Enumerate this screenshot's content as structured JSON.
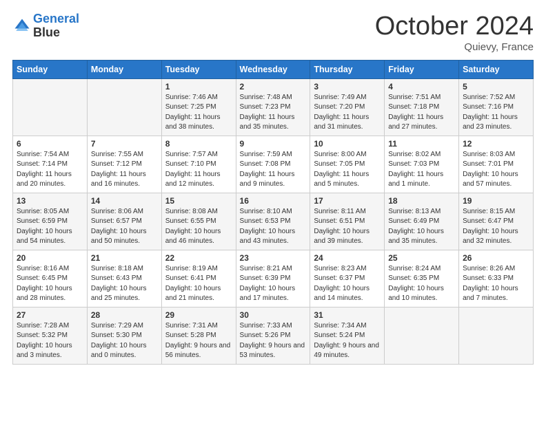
{
  "header": {
    "logo_line1": "General",
    "logo_line2": "Blue",
    "month": "October 2024",
    "location": "Quievy, France"
  },
  "days_of_week": [
    "Sunday",
    "Monday",
    "Tuesday",
    "Wednesday",
    "Thursday",
    "Friday",
    "Saturday"
  ],
  "weeks": [
    [
      {
        "day": "",
        "sunrise": "",
        "sunset": "",
        "daylight": ""
      },
      {
        "day": "",
        "sunrise": "",
        "sunset": "",
        "daylight": ""
      },
      {
        "day": "1",
        "sunrise": "Sunrise: 7:46 AM",
        "sunset": "Sunset: 7:25 PM",
        "daylight": "Daylight: 11 hours and 38 minutes."
      },
      {
        "day": "2",
        "sunrise": "Sunrise: 7:48 AM",
        "sunset": "Sunset: 7:23 PM",
        "daylight": "Daylight: 11 hours and 35 minutes."
      },
      {
        "day": "3",
        "sunrise": "Sunrise: 7:49 AM",
        "sunset": "Sunset: 7:20 PM",
        "daylight": "Daylight: 11 hours and 31 minutes."
      },
      {
        "day": "4",
        "sunrise": "Sunrise: 7:51 AM",
        "sunset": "Sunset: 7:18 PM",
        "daylight": "Daylight: 11 hours and 27 minutes."
      },
      {
        "day": "5",
        "sunrise": "Sunrise: 7:52 AM",
        "sunset": "Sunset: 7:16 PM",
        "daylight": "Daylight: 11 hours and 23 minutes."
      }
    ],
    [
      {
        "day": "6",
        "sunrise": "Sunrise: 7:54 AM",
        "sunset": "Sunset: 7:14 PM",
        "daylight": "Daylight: 11 hours and 20 minutes."
      },
      {
        "day": "7",
        "sunrise": "Sunrise: 7:55 AM",
        "sunset": "Sunset: 7:12 PM",
        "daylight": "Daylight: 11 hours and 16 minutes."
      },
      {
        "day": "8",
        "sunrise": "Sunrise: 7:57 AM",
        "sunset": "Sunset: 7:10 PM",
        "daylight": "Daylight: 11 hours and 12 minutes."
      },
      {
        "day": "9",
        "sunrise": "Sunrise: 7:59 AM",
        "sunset": "Sunset: 7:08 PM",
        "daylight": "Daylight: 11 hours and 9 minutes."
      },
      {
        "day": "10",
        "sunrise": "Sunrise: 8:00 AM",
        "sunset": "Sunset: 7:05 PM",
        "daylight": "Daylight: 11 hours and 5 minutes."
      },
      {
        "day": "11",
        "sunrise": "Sunrise: 8:02 AM",
        "sunset": "Sunset: 7:03 PM",
        "daylight": "Daylight: 11 hours and 1 minute."
      },
      {
        "day": "12",
        "sunrise": "Sunrise: 8:03 AM",
        "sunset": "Sunset: 7:01 PM",
        "daylight": "Daylight: 10 hours and 57 minutes."
      }
    ],
    [
      {
        "day": "13",
        "sunrise": "Sunrise: 8:05 AM",
        "sunset": "Sunset: 6:59 PM",
        "daylight": "Daylight: 10 hours and 54 minutes."
      },
      {
        "day": "14",
        "sunrise": "Sunrise: 8:06 AM",
        "sunset": "Sunset: 6:57 PM",
        "daylight": "Daylight: 10 hours and 50 minutes."
      },
      {
        "day": "15",
        "sunrise": "Sunrise: 8:08 AM",
        "sunset": "Sunset: 6:55 PM",
        "daylight": "Daylight: 10 hours and 46 minutes."
      },
      {
        "day": "16",
        "sunrise": "Sunrise: 8:10 AM",
        "sunset": "Sunset: 6:53 PM",
        "daylight": "Daylight: 10 hours and 43 minutes."
      },
      {
        "day": "17",
        "sunrise": "Sunrise: 8:11 AM",
        "sunset": "Sunset: 6:51 PM",
        "daylight": "Daylight: 10 hours and 39 minutes."
      },
      {
        "day": "18",
        "sunrise": "Sunrise: 8:13 AM",
        "sunset": "Sunset: 6:49 PM",
        "daylight": "Daylight: 10 hours and 35 minutes."
      },
      {
        "day": "19",
        "sunrise": "Sunrise: 8:15 AM",
        "sunset": "Sunset: 6:47 PM",
        "daylight": "Daylight: 10 hours and 32 minutes."
      }
    ],
    [
      {
        "day": "20",
        "sunrise": "Sunrise: 8:16 AM",
        "sunset": "Sunset: 6:45 PM",
        "daylight": "Daylight: 10 hours and 28 minutes."
      },
      {
        "day": "21",
        "sunrise": "Sunrise: 8:18 AM",
        "sunset": "Sunset: 6:43 PM",
        "daylight": "Daylight: 10 hours and 25 minutes."
      },
      {
        "day": "22",
        "sunrise": "Sunrise: 8:19 AM",
        "sunset": "Sunset: 6:41 PM",
        "daylight": "Daylight: 10 hours and 21 minutes."
      },
      {
        "day": "23",
        "sunrise": "Sunrise: 8:21 AM",
        "sunset": "Sunset: 6:39 PM",
        "daylight": "Daylight: 10 hours and 17 minutes."
      },
      {
        "day": "24",
        "sunrise": "Sunrise: 8:23 AM",
        "sunset": "Sunset: 6:37 PM",
        "daylight": "Daylight: 10 hours and 14 minutes."
      },
      {
        "day": "25",
        "sunrise": "Sunrise: 8:24 AM",
        "sunset": "Sunset: 6:35 PM",
        "daylight": "Daylight: 10 hours and 10 minutes."
      },
      {
        "day": "26",
        "sunrise": "Sunrise: 8:26 AM",
        "sunset": "Sunset: 6:33 PM",
        "daylight": "Daylight: 10 hours and 7 minutes."
      }
    ],
    [
      {
        "day": "27",
        "sunrise": "Sunrise: 7:28 AM",
        "sunset": "Sunset: 5:32 PM",
        "daylight": "Daylight: 10 hours and 3 minutes."
      },
      {
        "day": "28",
        "sunrise": "Sunrise: 7:29 AM",
        "sunset": "Sunset: 5:30 PM",
        "daylight": "Daylight: 10 hours and 0 minutes."
      },
      {
        "day": "29",
        "sunrise": "Sunrise: 7:31 AM",
        "sunset": "Sunset: 5:28 PM",
        "daylight": "Daylight: 9 hours and 56 minutes."
      },
      {
        "day": "30",
        "sunrise": "Sunrise: 7:33 AM",
        "sunset": "Sunset: 5:26 PM",
        "daylight": "Daylight: 9 hours and 53 minutes."
      },
      {
        "day": "31",
        "sunrise": "Sunrise: 7:34 AM",
        "sunset": "Sunset: 5:24 PM",
        "daylight": "Daylight: 9 hours and 49 minutes."
      },
      {
        "day": "",
        "sunrise": "",
        "sunset": "",
        "daylight": ""
      },
      {
        "day": "",
        "sunrise": "",
        "sunset": "",
        "daylight": ""
      }
    ]
  ]
}
